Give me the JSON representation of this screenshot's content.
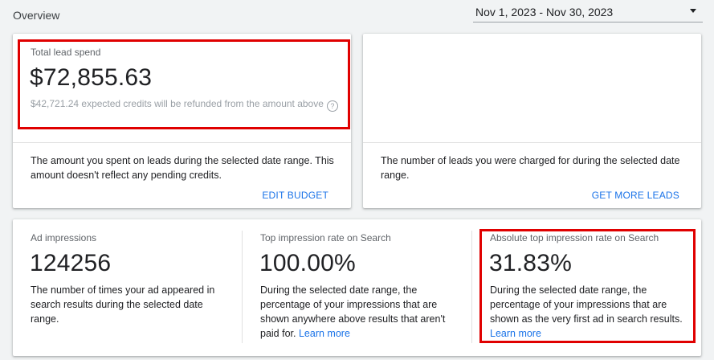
{
  "header": {
    "title": "Overview",
    "date_range": "Nov 1, 2023 - Nov 30, 2023"
  },
  "spend_card": {
    "label": "Total lead spend",
    "value": "$72,855.63",
    "credits_note": "$42,721.24 expected credits will be refunded from the amount above",
    "description": "The amount you spent on leads during the selected date range. This amount doesn't reflect any pending credits.",
    "action": "EDIT BUDGET"
  },
  "leads_card": {
    "description": "The number of leads you were charged for during the selected date range.",
    "action": "GET MORE LEADS"
  },
  "impressions_card": {
    "columns": [
      {
        "label": "Ad impressions",
        "value": "124256",
        "description": "The number of times your ad appeared in search results during the selected date range."
      },
      {
        "label": "Top impression rate on Search",
        "value": "100.00%",
        "description": "During the selected date range, the percentage of your impressions that are shown anywhere above results that aren't paid for.",
        "link": "Learn more"
      },
      {
        "label": "Absolute top impression rate on Search",
        "value": "31.83%",
        "description": "During the selected date range, the percentage of your impressions that are shown as the very first ad in search results.",
        "link": "Learn more"
      }
    ]
  },
  "colors": {
    "link": "#1a73e8",
    "highlight": "#e00000"
  }
}
